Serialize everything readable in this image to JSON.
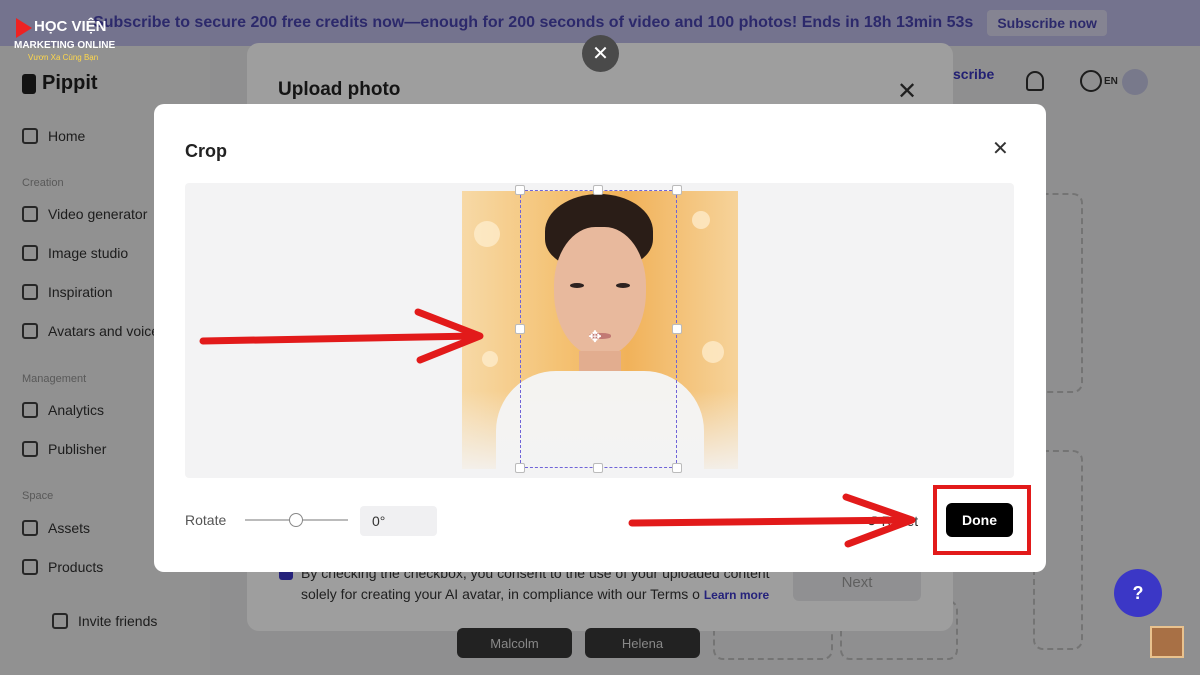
{
  "banner": {
    "text": "Subscribe to secure 200 free credits now—enough for 200 seconds of video and 100 photos! Ends in 18h 13min 53s",
    "button": "Subscribe now"
  },
  "logo": {
    "line1": "HỌC VIỆN",
    "line2": "MARKETING ONLINE",
    "line3": "Vươn Xa Cùng Bạn"
  },
  "sidebar": {
    "brand": "Pippit",
    "home": "Home",
    "section_creation": "Creation",
    "video_generator": "Video generator",
    "image_studio": "Image studio",
    "inspiration": "Inspiration",
    "avatars": "Avatars and voices",
    "section_management": "Management",
    "analytics": "Analytics",
    "publisher": "Publisher",
    "section_space": "Space",
    "assets": "Assets",
    "products": "Products",
    "invite": "Invite friends"
  },
  "header": {
    "subscribe_partial": "scribe",
    "lang": "EN"
  },
  "upload_modal": {
    "title": "Upload photo",
    "consent_text": "By checking the checkbox, you consent to the use of your uploaded content solely for creating your AI avatar, in compliance with our Terms o",
    "learn_more": "Learn more",
    "next": "Next"
  },
  "name_chips": [
    "Malcolm",
    "Helena"
  ],
  "crop_modal": {
    "title": "Crop",
    "rotate_label": "Rotate",
    "rotate_value": "0°",
    "reset": "Reset",
    "done": "Done"
  },
  "colors": {
    "accent": "#3b37c6",
    "annotation_red": "#e21a1a"
  }
}
